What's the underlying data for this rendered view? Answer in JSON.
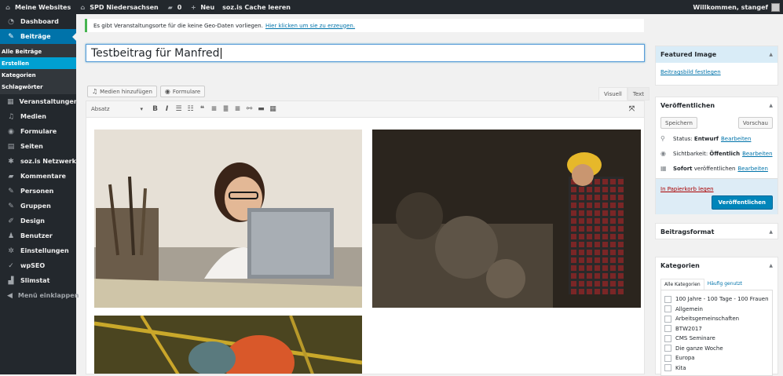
{
  "adminbar": {
    "sites": "Meine Websites",
    "site": "SPD Niedersachsen",
    "comments": "0",
    "new": "Neu",
    "cache": "soz.is Cache leeren",
    "welcome": "Willkommen, stangef"
  },
  "sidebar": {
    "items": [
      {
        "label": "Dashboard",
        "icon": "dashboard-icon"
      },
      {
        "label": "Beiträge",
        "icon": "pin-icon"
      },
      {
        "label": "Veranstaltungen",
        "icon": "calendar-icon"
      },
      {
        "label": "Medien",
        "icon": "media-icon"
      },
      {
        "label": "Formulare",
        "icon": "forms-icon"
      },
      {
        "label": "Seiten",
        "icon": "pages-icon"
      },
      {
        "label": "soz.is Netzwerk",
        "icon": "network-icon"
      },
      {
        "label": "Kommentare",
        "icon": "comments-icon"
      },
      {
        "label": "Personen",
        "icon": "people-icon"
      },
      {
        "label": "Gruppen",
        "icon": "groups-icon"
      },
      {
        "label": "Design",
        "icon": "brush-icon"
      },
      {
        "label": "Benutzer",
        "icon": "user-icon"
      },
      {
        "label": "Einstellungen",
        "icon": "settings-icon"
      },
      {
        "label": "wpSEO",
        "icon": "seo-icon"
      },
      {
        "label": "Slimstat",
        "icon": "stats-icon"
      },
      {
        "label": "Menü einklappen",
        "icon": "collapse-icon"
      }
    ],
    "sub": [
      "Alle Beiträge",
      "Erstellen",
      "Kategorien",
      "Schlagwörter"
    ]
  },
  "notice": {
    "text": "Es gibt Veranstaltungsorte für die keine Geo-Daten vorliegen.",
    "link": "Hier klicken um sie zu erzeugen."
  },
  "title": "Testbeitrag für Manfred",
  "editor": {
    "media_button": "Medien hinzufügen",
    "forms_button": "Formulare",
    "tab_visual": "Visuell",
    "tab_text": "Text",
    "format": "Absatz"
  },
  "featured": {
    "title": "Featured Image",
    "link": "Beitragsbild festlegen"
  },
  "publish": {
    "title": "Veröffentlichen",
    "save": "Speichern",
    "preview": "Vorschau",
    "status_label": "Status:",
    "status_value": "Entwurf",
    "visibility_label": "Sichtbarkeit:",
    "visibility_value": "Öffentlich",
    "schedule_value": "Sofort",
    "schedule_label": "veröffentlichen",
    "edit": "Bearbeiten",
    "trash": "In Papierkorb legen",
    "publish_button": "Veröffentlichen"
  },
  "format_box": {
    "title": "Beitragsformat"
  },
  "categories": {
    "title": "Kategorien",
    "tab_all": "Alle Kategorien",
    "tab_common": "Häufig genutzt",
    "items": [
      "100 Jahre - 100 Tage - 100 Frauen",
      "Allgemein",
      "Arbeitsgemeinschaften",
      "BTW2017",
      "CMS Seminare",
      "Die ganze Woche",
      "Europa",
      "Kita"
    ]
  }
}
